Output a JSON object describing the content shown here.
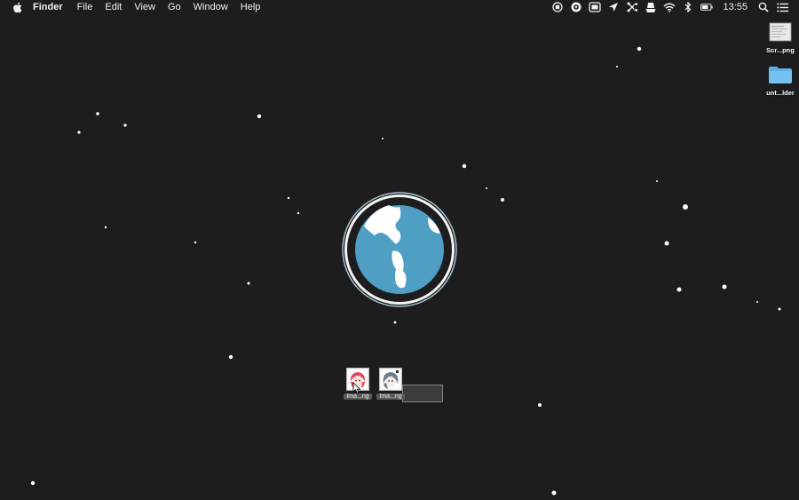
{
  "menubar": {
    "app_name": "Finder",
    "items": [
      "File",
      "Edit",
      "View",
      "Go",
      "Window",
      "Help"
    ],
    "clock": "13:55",
    "status_icons": [
      "record-icon",
      "disc-icon",
      "display-icon",
      "location-arrow-icon",
      "scissors-icon",
      "alfred-hat-icon",
      "wifi-icon",
      "bluetooth-icon",
      "battery-icon",
      "search-icon",
      "list-icon"
    ]
  },
  "desktop_icons": [
    {
      "label": "Scr...png",
      "icon": "screenshot-file-icon"
    },
    {
      "label": "unt...lder",
      "icon": "folder-icon"
    }
  ],
  "dragged_files": [
    {
      "label": "Ima...ng",
      "icon": "image-thumbnail-red-hair-icon"
    },
    {
      "label": "Ima...ng",
      "icon": "image-thumbnail-grey-hair-icon"
    }
  ],
  "colors": {
    "background": "#1d1d1f",
    "globe_ocean": "#4f9fc4",
    "globe_ring": "#a8c8da",
    "folder": "#5cb0e8"
  }
}
